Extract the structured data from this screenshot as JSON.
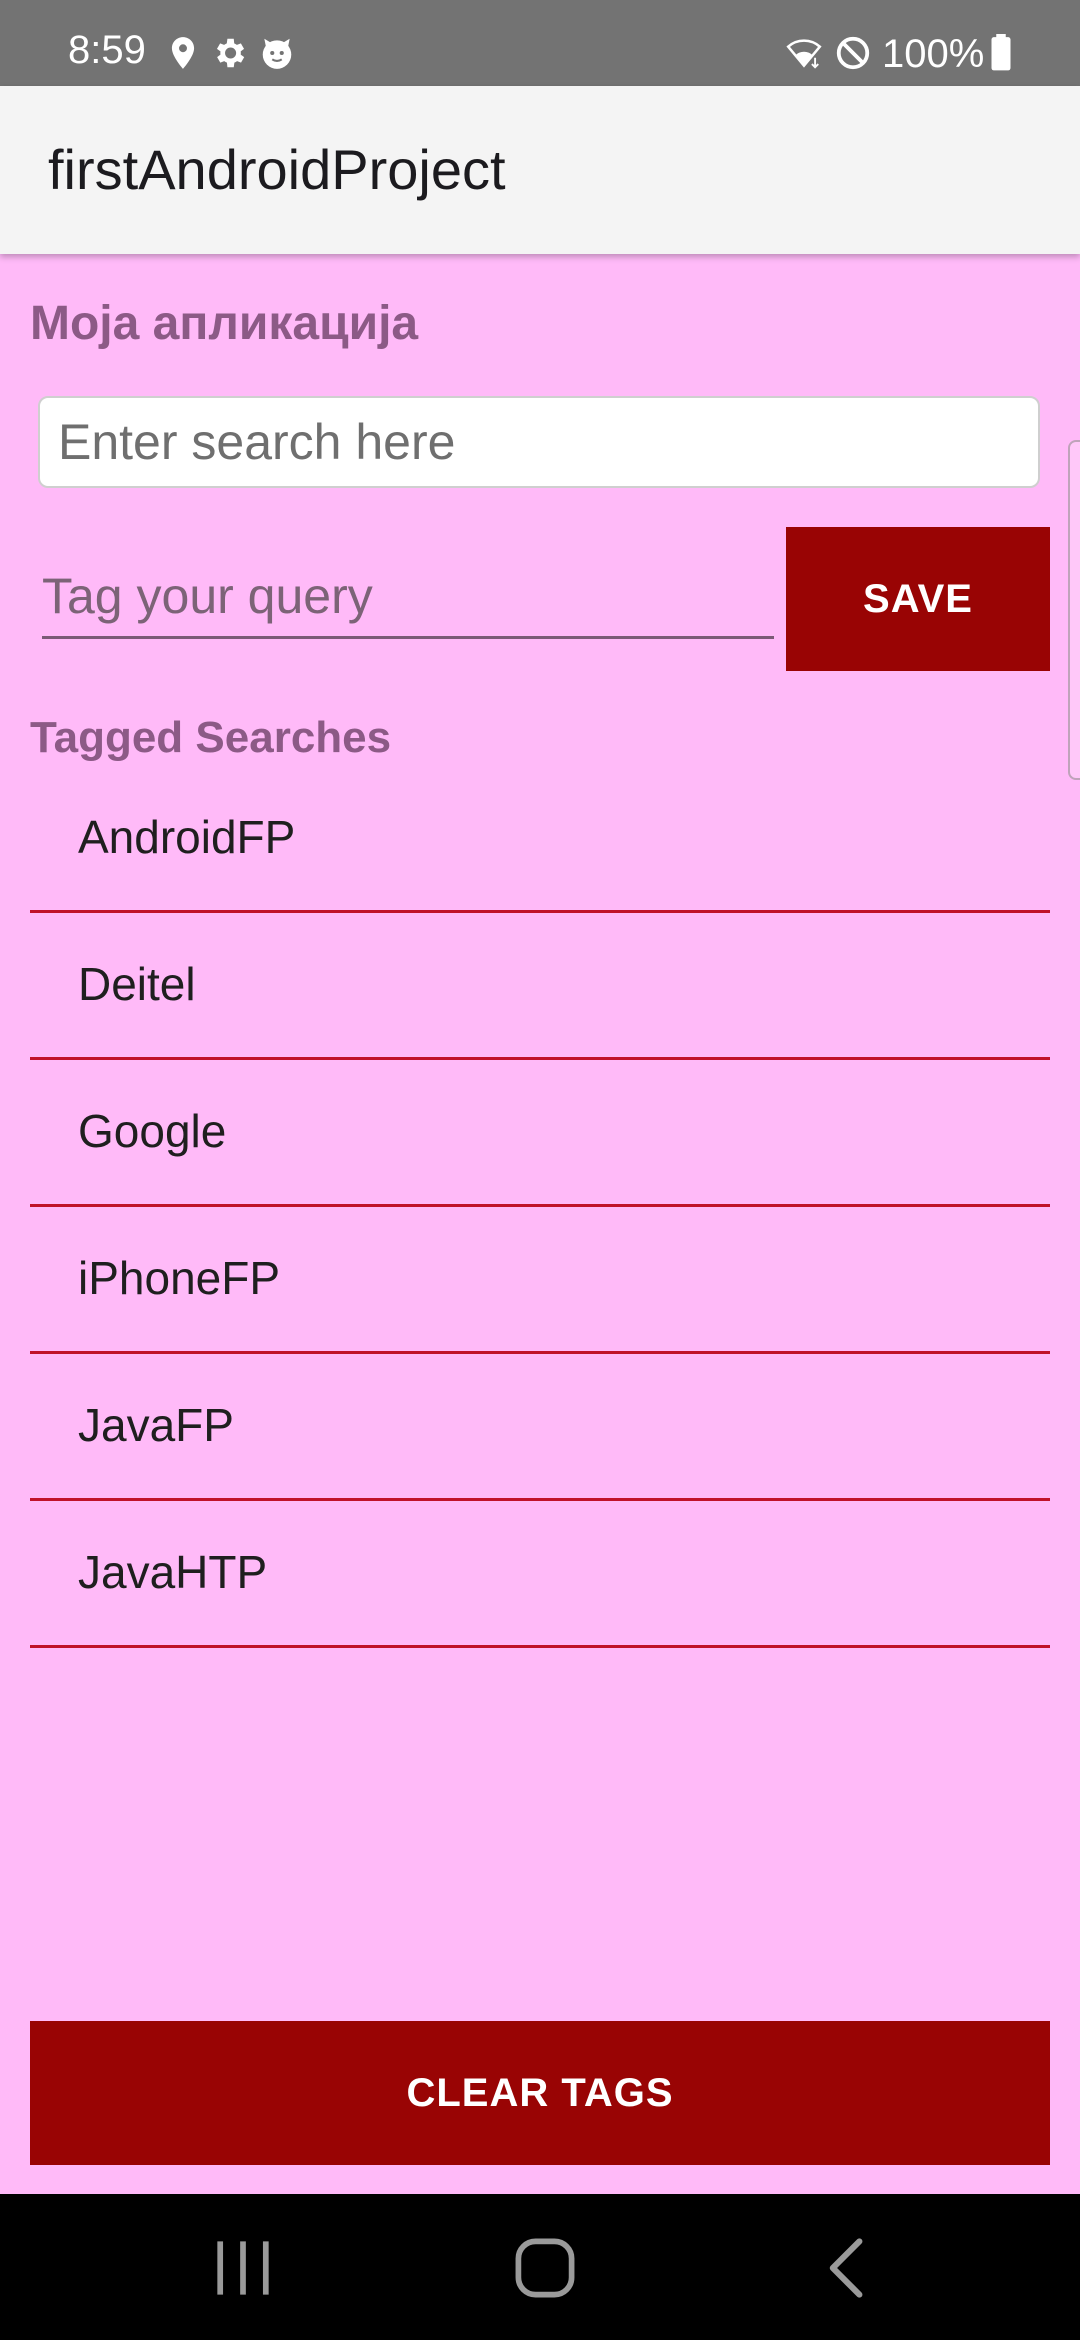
{
  "status_bar": {
    "time": "8:59",
    "battery": "100%",
    "icons": [
      "location-icon",
      "settings-icon",
      "cat-face-icon",
      "wifi-icon",
      "do-not-disturb-icon",
      "battery-icon"
    ]
  },
  "app_bar": {
    "title": "firstAndroidProject"
  },
  "main": {
    "app_heading": "Моја апликација",
    "search": {
      "placeholder": "Enter search here",
      "value": ""
    },
    "tag": {
      "placeholder": "Tag your query",
      "value": ""
    },
    "save_label": "SAVE",
    "tagged_heading": "Tagged Searches",
    "tags": [
      "AndroidFP",
      "Deitel",
      "Google",
      "iPhoneFP",
      "JavaFP",
      "JavaHTP"
    ],
    "clear_label": "CLEAR TAGS"
  },
  "nav_bar": {
    "icons": [
      "recent-apps-icon",
      "home-icon",
      "back-icon"
    ]
  },
  "colors": {
    "background": "#ffbaf8",
    "accent_button": "#990404",
    "divider": "#c0122a",
    "heading": "#8c5a86",
    "status_bar": "#737373",
    "app_bar": "#f4f4f4"
  }
}
